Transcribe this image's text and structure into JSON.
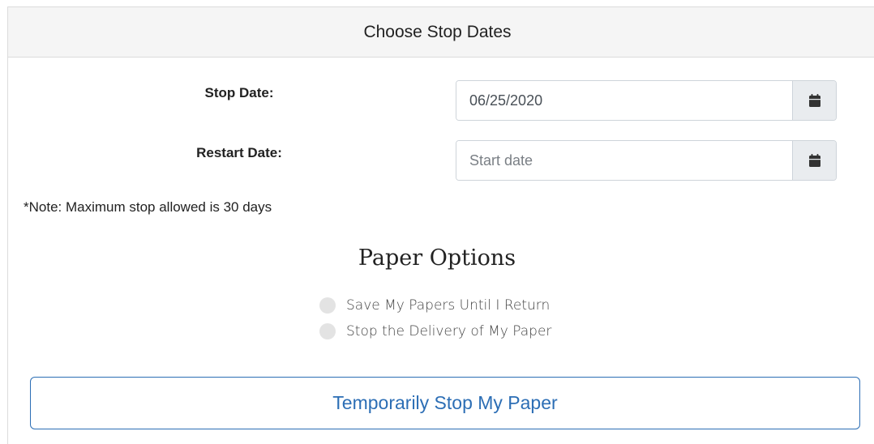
{
  "header": {
    "title": "Choose Stop Dates"
  },
  "stop_date": {
    "label": "Stop Date:",
    "value": "06/25/2020",
    "placeholder": ""
  },
  "restart_date": {
    "label": "Restart Date:",
    "value": "",
    "placeholder": "Start date"
  },
  "note": "*Note: Maximum stop allowed is 30 days",
  "paper_options": {
    "title": "Paper Options",
    "options": [
      {
        "label": "Save My Papers Until I Return"
      },
      {
        "label": "Stop the Delivery of My Paper"
      }
    ]
  },
  "submit_label": "Temporarily Stop My Paper",
  "icons": {
    "calendar": "calendar-icon"
  },
  "colors": {
    "accent": "#2c6eb5",
    "header_bg": "#f5f5f5",
    "addon_bg": "#e9ecef",
    "radio": "#e3e3e3"
  }
}
